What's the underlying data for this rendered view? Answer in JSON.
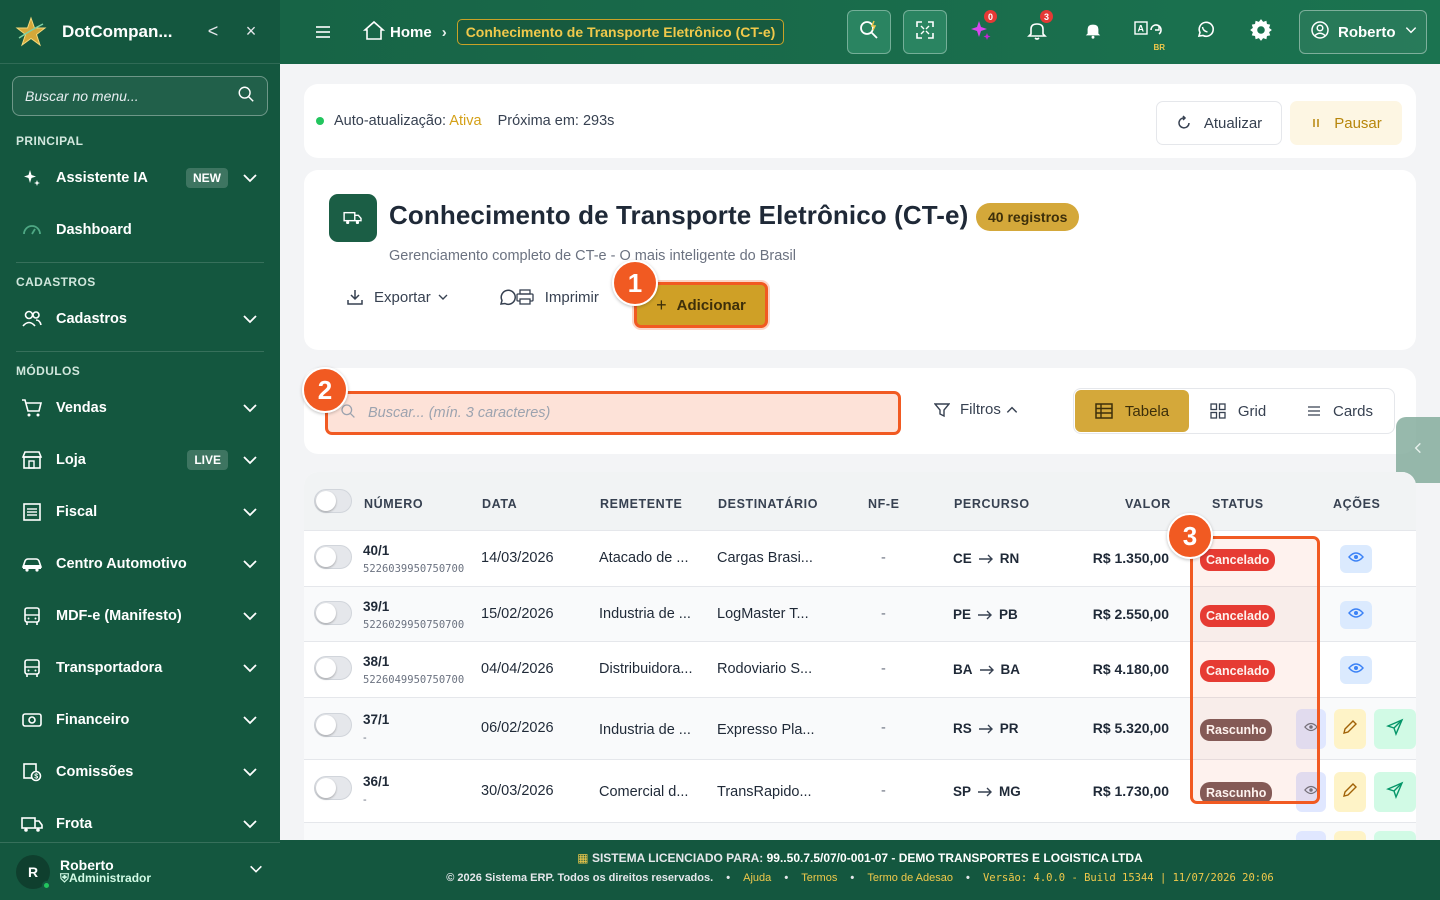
{
  "sidebar": {
    "brand": "DotCompan...",
    "collapse_label": "<",
    "close_label": "×",
    "search_placeholder": "Buscar no menu...",
    "sections": {
      "principal": "PRINCIPAL",
      "cadastros": "CADASTROS",
      "modulos": "MÓDULOS"
    },
    "items": [
      {
        "label": "Assistente IA",
        "badge": "NEW"
      },
      {
        "label": "Dashboard"
      },
      {
        "label": "Cadastros"
      },
      {
        "label": "Vendas"
      },
      {
        "label": "Loja",
        "badge": "LIVE"
      },
      {
        "label": "Fiscal"
      },
      {
        "label": "Centro Automotivo"
      },
      {
        "label": "MDF-e (Manifesto)"
      },
      {
        "label": "Transportadora"
      },
      {
        "label": "Financeiro"
      },
      {
        "label": "Comissões"
      },
      {
        "label": "Frota"
      }
    ],
    "user": {
      "initial": "R",
      "name": "Roberto",
      "role": "Administrador"
    }
  },
  "topbar": {
    "home": "Home",
    "current": "Conhecimento de Transporte Eletrônico (CT-e)",
    "ai_count": "0",
    "notif_count": "3",
    "lang_sub": "BR",
    "user_name": "Roberto"
  },
  "auto_refresh": {
    "label": "Auto-atualização:",
    "state": "Ativa",
    "next_label": "Próxima em:",
    "next_value": "293s",
    "refresh_button": "Atualizar",
    "pause_button": "Pausar"
  },
  "header": {
    "title": "Conhecimento de Transporte Eletrônico (CT-e)",
    "count_badge": "40 registros",
    "subtitle": "Gerenciamento completo de CT-e - O mais inteligente do Brasil",
    "export": "Exportar",
    "print": "Imprimir",
    "add": "Adicionar"
  },
  "markers": [
    "1",
    "2",
    "3"
  ],
  "filters": {
    "search_placeholder": "Buscar... (mín. 3 caracteres)",
    "filters_label": "Filtros",
    "views": [
      "Tabela",
      "Grid",
      "Cards"
    ]
  },
  "table": {
    "headers": [
      "NÚMERO",
      "DATA",
      "REMETENTE",
      "DESTINATÁRIO",
      "NF-E",
      "PERCURSO",
      "VALOR",
      "STATUS",
      "AÇÕES"
    ],
    "rows": [
      {
        "numero": "40/1",
        "chave": "5226039950750700",
        "data": "14/03/2026",
        "remetente": "Atacado de ...",
        "destinatario": "Cargas Brasi...",
        "nfe": "-",
        "origem": "CE",
        "destino": "RN",
        "valor": "R$ 1.350,00",
        "status": "Cancelado"
      },
      {
        "numero": "39/1",
        "chave": "5226029950750700",
        "data": "15/02/2026",
        "remetente": "Industria de ...",
        "destinatario": "LogMaster T...",
        "nfe": "-",
        "origem": "PE",
        "destino": "PB",
        "valor": "R$ 2.550,00",
        "status": "Cancelado"
      },
      {
        "numero": "38/1",
        "chave": "5226049950750700",
        "data": "04/04/2026",
        "remetente": "Distribuidora...",
        "destinatario": "Rodoviario S...",
        "nfe": "-",
        "origem": "BA",
        "destino": "BA",
        "valor": "R$ 4.180,00",
        "status": "Cancelado"
      },
      {
        "numero": "37/1",
        "chave": "-",
        "data": "06/02/2026",
        "remetente": "Industria de ...",
        "destinatario": "Expresso Pla...",
        "nfe": "-",
        "origem": "RS",
        "destino": "PR",
        "valor": "R$ 5.320,00",
        "status": "Rascunho"
      },
      {
        "numero": "36/1",
        "chave": "-",
        "data": "30/03/2026",
        "remetente": "Comercial d...",
        "destinatario": "TransRapido...",
        "nfe": "-",
        "origem": "SP",
        "destino": "MG",
        "valor": "R$ 1.730,00",
        "status": "Rascunho"
      }
    ]
  },
  "footer": {
    "license_label": "SISTEMA LICENCIADO PARA:",
    "license_value": "99..50.7.5/07/0-001-07 - DEMO TRANSPORTES E LOGISTICA LTDA",
    "copyright": "© 2026 Sistema ERP. Todos os direitos reservados.",
    "links": [
      "Ajuda",
      "Termos",
      "Termo de Adesao"
    ],
    "version": "Versão: 4.0.0 - Build 15344 | 11/07/2026 20:06"
  },
  "colors": {
    "sidebar": "#14573f",
    "accent_gold": "#d4a83a",
    "highlight": "#f15a22",
    "cancel": "#e53935",
    "draft": "#7b5b5b"
  }
}
